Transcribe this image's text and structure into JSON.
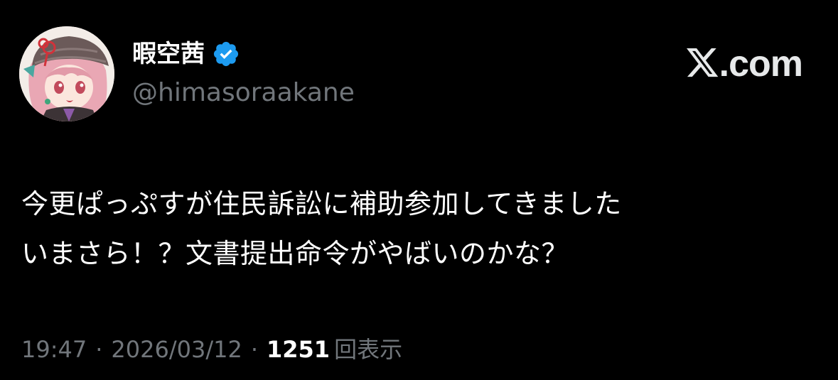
{
  "user": {
    "display_name": "暇空茜",
    "handle": "@himasoraakane",
    "verified_icon": "verified-badge-icon",
    "avatar_icon": "avatar-illustration"
  },
  "brand": {
    "logo_icon": "x-logo-icon",
    "text": ".com"
  },
  "tweet": {
    "lines": [
      "今更ぱっぷすが住民訴訟に補助参加してきました",
      "いまさら！？文書提出命令がやばいのかな？"
    ]
  },
  "meta": {
    "time": "19:47",
    "separator": "·",
    "date": "2026/03/12",
    "view_count": "1251",
    "views_label": "回表示"
  },
  "colors": {
    "background": "#000000",
    "primary_text": "#ffffff",
    "secondary_text": "#71767b",
    "verified_blue": "#1d9bf0"
  }
}
